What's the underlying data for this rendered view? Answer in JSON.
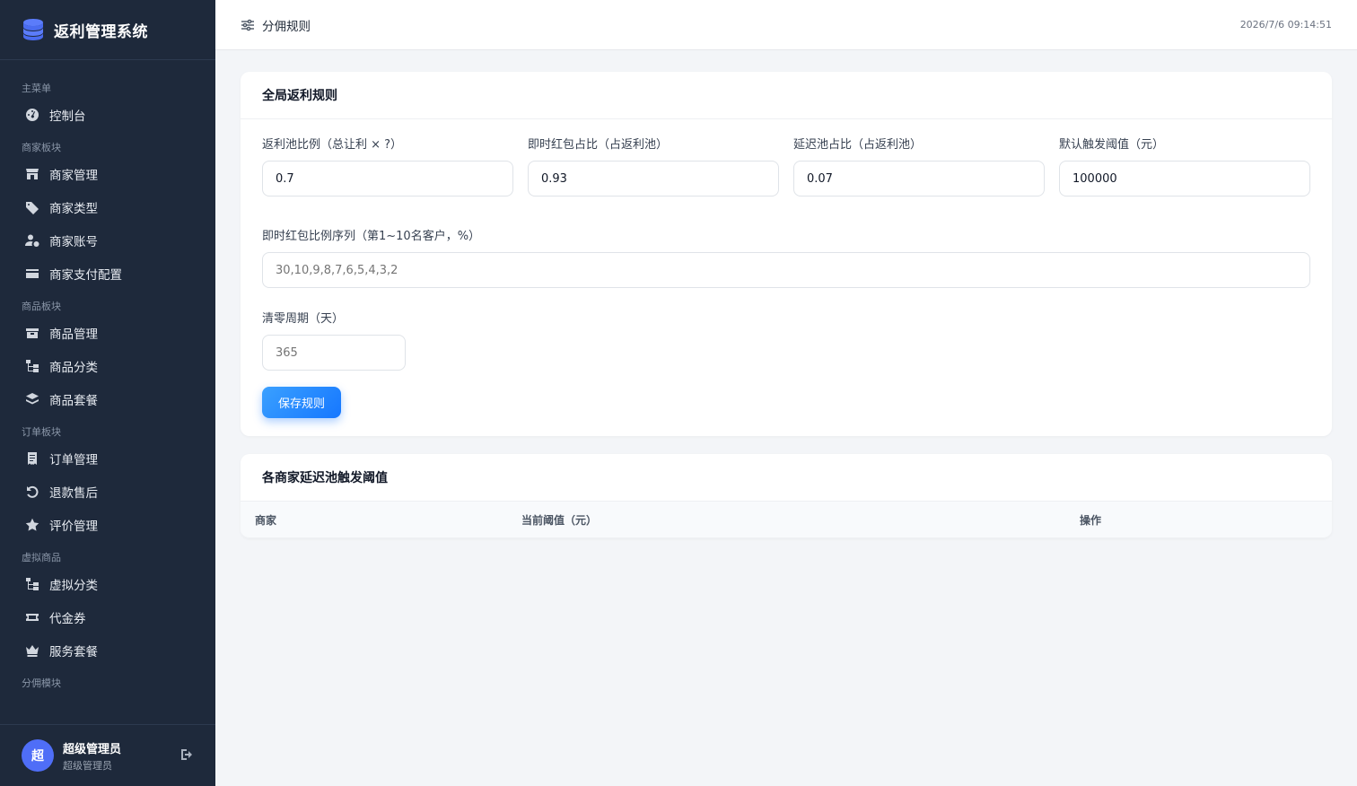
{
  "app": {
    "title": "返利管理系统"
  },
  "sidebar": {
    "sections": [
      {
        "title": "主菜单",
        "items": [
          {
            "label": "控制台",
            "icon": "dashboard-icon"
          }
        ]
      },
      {
        "title": "商家板块",
        "items": [
          {
            "label": "商家管理",
            "icon": "store-icon"
          },
          {
            "label": "商家类型",
            "icon": "tags-icon"
          },
          {
            "label": "商家账号",
            "icon": "user-gear-icon"
          },
          {
            "label": "商家支付配置",
            "icon": "credit-card-icon"
          }
        ]
      },
      {
        "title": "商品板块",
        "items": [
          {
            "label": "商品管理",
            "icon": "box-icon"
          },
          {
            "label": "商品分类",
            "icon": "sitemap-icon"
          },
          {
            "label": "商品套餐",
            "icon": "layers-icon"
          }
        ]
      },
      {
        "title": "订单板块",
        "items": [
          {
            "label": "订单管理",
            "icon": "receipt-icon"
          },
          {
            "label": "退款售后",
            "icon": "undo-icon"
          },
          {
            "label": "评价管理",
            "icon": "star-icon"
          }
        ]
      },
      {
        "title": "虚拟商品",
        "items": [
          {
            "label": "虚拟分类",
            "icon": "sitemap-icon"
          },
          {
            "label": "代金券",
            "icon": "ticket-icon"
          },
          {
            "label": "服务套餐",
            "icon": "crown-icon"
          }
        ]
      },
      {
        "title": "分佣模块",
        "items": []
      }
    ]
  },
  "user": {
    "avatar_char": "超",
    "name": "超级管理员",
    "role": "超级管理员"
  },
  "header": {
    "title": "分佣规则",
    "time": "2026/7/6 09:14:51"
  },
  "global_rules": {
    "title": "全局返利规则",
    "fields": {
      "pool_ratio": {
        "label": "返利池比例（总让利 × ?）",
        "value": "0.7"
      },
      "instant_ratio": {
        "label": "即时红包占比（占返利池）",
        "value": "0.93"
      },
      "delay_ratio": {
        "label": "延迟池占比（占返利池）",
        "value": "0.07"
      },
      "trigger_threshold": {
        "label": "默认触发阈值（元）",
        "value": "100000"
      },
      "sequence": {
        "label": "即时红包比例序列（第1~10名客户，%）",
        "placeholder": "30,10,9,8,7,6,5,4,3,2"
      },
      "reset_cycle": {
        "label": "清零周期（天）",
        "placeholder": "365"
      }
    },
    "save_label": "保存规则"
  },
  "merchant_thresholds": {
    "title": "各商家延迟池触发阈值",
    "columns": [
      "商家",
      "当前阈值（元）",
      "操作"
    ]
  }
}
